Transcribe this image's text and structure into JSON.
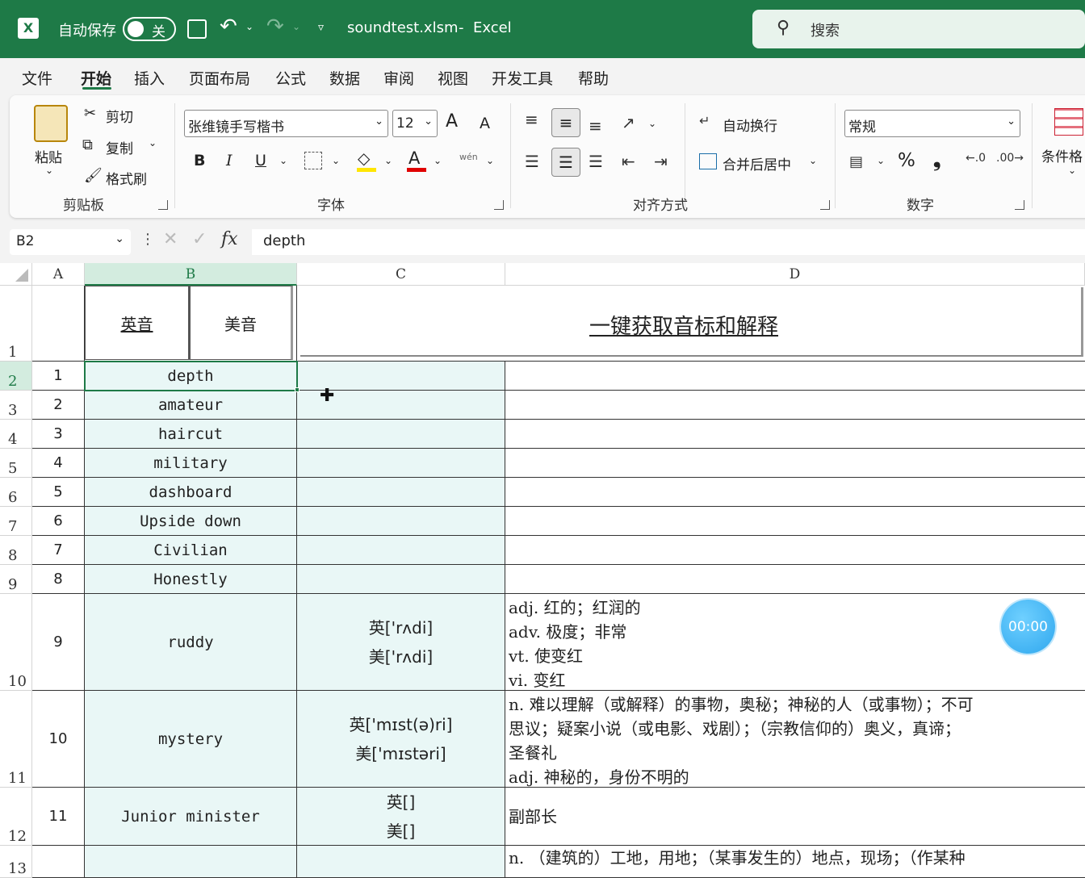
{
  "titlebar": {
    "autosave_label": "自动保存",
    "autosave_toggle": "关",
    "filename": "soundtest.xlsm",
    "separator": "-",
    "app_name": "Excel",
    "search_placeholder": "搜索"
  },
  "menu": [
    "文件",
    "开始",
    "插入",
    "页面布局",
    "公式",
    "数据",
    "审阅",
    "视图",
    "开发工具",
    "帮助"
  ],
  "ribbon": {
    "clipboard": {
      "paste": "粘贴",
      "cut": "剪切",
      "copy": "复制",
      "format_painter": "格式刷",
      "group": "剪贴板"
    },
    "font": {
      "font_name": "张维镜手写楷书",
      "font_size": "12",
      "bold": "B",
      "italic": "I",
      "underline": "U",
      "grow": "A",
      "shrink": "A",
      "color_a": "A",
      "phonetic": "wén",
      "group": "字体"
    },
    "alignment": {
      "wrap_text": "自动换行",
      "merge_center": "合并后居中",
      "group": "对齐方式"
    },
    "number": {
      "format": "常规",
      "percent": "%",
      "comma": "❟",
      "group": "数字"
    },
    "styles": {
      "conditional": "条件格"
    }
  },
  "formula_bar": {
    "name_box": "B2",
    "fx": "fx",
    "content": "depth"
  },
  "columns": [
    "A",
    "B",
    "C",
    "D"
  ],
  "header_row": {
    "row": "1",
    "b_left": "英音",
    "b_right": "美音",
    "d_title": "一键获取音标和解释"
  },
  "rows": [
    {
      "row": "2",
      "a": "1",
      "b": "depth",
      "c": "",
      "d": ""
    },
    {
      "row": "3",
      "a": "2",
      "b": "amateur",
      "c": "",
      "d": ""
    },
    {
      "row": "4",
      "a": "3",
      "b": "haircut",
      "c": "",
      "d": ""
    },
    {
      "row": "5",
      "a": "4",
      "b": "military",
      "c": "",
      "d": ""
    },
    {
      "row": "6",
      "a": "5",
      "b": "dashboard",
      "c": "",
      "d": ""
    },
    {
      "row": "7",
      "a": "6",
      "b": "Upside down",
      "c": "",
      "d": ""
    },
    {
      "row": "8",
      "a": "7",
      "b": "Civilian",
      "c": "",
      "d": ""
    },
    {
      "row": "9",
      "a": "8",
      "b": "Honestly",
      "c": "",
      "d": ""
    },
    {
      "row": "10",
      "a": "9",
      "b": "ruddy",
      "c1": "英['rʌdi]",
      "c2": "美['rʌdi]",
      "d_lines": [
        "adj. 红的；红润的",
        "adv. 极度；非常",
        "vt. 使变红",
        "vi. 变红"
      ]
    },
    {
      "row": "11",
      "a": "10",
      "b": "mystery",
      "c1": "英['mɪst(ə)ri]",
      "c2": "美['mɪstəri]",
      "d_lines": [
        "n. 难以理解（或解释）的事物，奥秘；神秘的人（或事物）；不可",
        "思议；疑案小说（或电影、戏剧）；（宗教信仰的）奥义，真谛；",
        "圣餐礼",
        "adj. 神秘的，身份不明的"
      ]
    },
    {
      "row": "12",
      "a": "11",
      "b": "Junior minister",
      "c1": "英[]",
      "c2": "美[]",
      "d_lines": [
        "副部长"
      ]
    },
    {
      "row": "13",
      "d_partial": "n. （建筑的）工地，用地；（某事发生的）地点，现场；（作某种"
    }
  ],
  "timer": "00:00",
  "colors": {
    "title_green": "#1e7a47",
    "cell_fill": "#e9f7f6",
    "timer_blue": "#2fa7ee"
  }
}
